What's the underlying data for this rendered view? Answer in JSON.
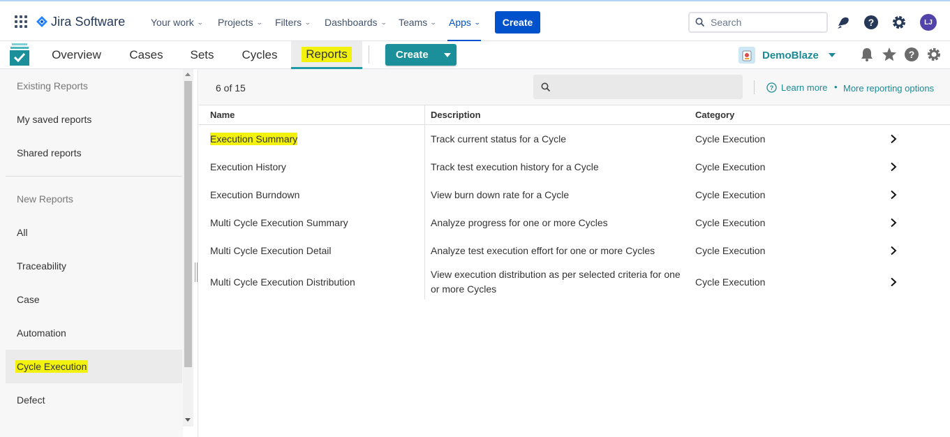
{
  "topbar": {
    "logo_text": "Jira Software",
    "nav": [
      {
        "label": "Your work"
      },
      {
        "label": "Projects"
      },
      {
        "label": "Filters"
      },
      {
        "label": "Dashboards"
      },
      {
        "label": "Teams"
      },
      {
        "label": "Apps"
      }
    ],
    "create_label": "Create",
    "search_placeholder": "Search",
    "avatar_initials": "LJ"
  },
  "subbar": {
    "tabs": [
      {
        "label": "Overview"
      },
      {
        "label": "Cases"
      },
      {
        "label": "Sets"
      },
      {
        "label": "Cycles"
      },
      {
        "label": "Reports"
      }
    ],
    "create_label": "Create",
    "project_name": "DemoBlaze"
  },
  "sidebar": {
    "existing_header": "Existing Reports",
    "existing_items": [
      {
        "label": "My saved reports"
      },
      {
        "label": "Shared reports"
      }
    ],
    "new_header": "New Reports",
    "new_items": [
      {
        "label": "All"
      },
      {
        "label": "Traceability"
      },
      {
        "label": "Case"
      },
      {
        "label": "Automation"
      },
      {
        "label": "Cycle Execution"
      },
      {
        "label": "Defect"
      }
    ]
  },
  "main": {
    "count": "6 of 15",
    "learn_more": "Learn more",
    "separator": "•",
    "more_options": "More reporting options",
    "columns": {
      "name": "Name",
      "description": "Description",
      "category": "Category"
    },
    "rows": [
      {
        "name": "Execution Summary",
        "description": "Track current status for a Cycle",
        "category": "Cycle Execution"
      },
      {
        "name": "Execution History",
        "description": "Track test execution history for a Cycle",
        "category": "Cycle Execution"
      },
      {
        "name": "Execution Burndown",
        "description": "View burn down rate for a Cycle",
        "category": "Cycle Execution"
      },
      {
        "name": "Multi Cycle Execution Summary",
        "description": "Analyze progress for one or more Cycles",
        "category": "Cycle Execution"
      },
      {
        "name": "Multi Cycle Execution Detail",
        "description": "Analyze test execution effort for one or more Cycles",
        "category": "Cycle Execution"
      },
      {
        "name": "Multi Cycle Execution Distribution",
        "description": "View execution distribution as per selected criteria for one or more Cycles",
        "category": "Cycle Execution"
      }
    ]
  },
  "colors": {
    "jira_blue": "#0052cc",
    "teal": "#1b909a",
    "highlight": "#f2f20e"
  }
}
